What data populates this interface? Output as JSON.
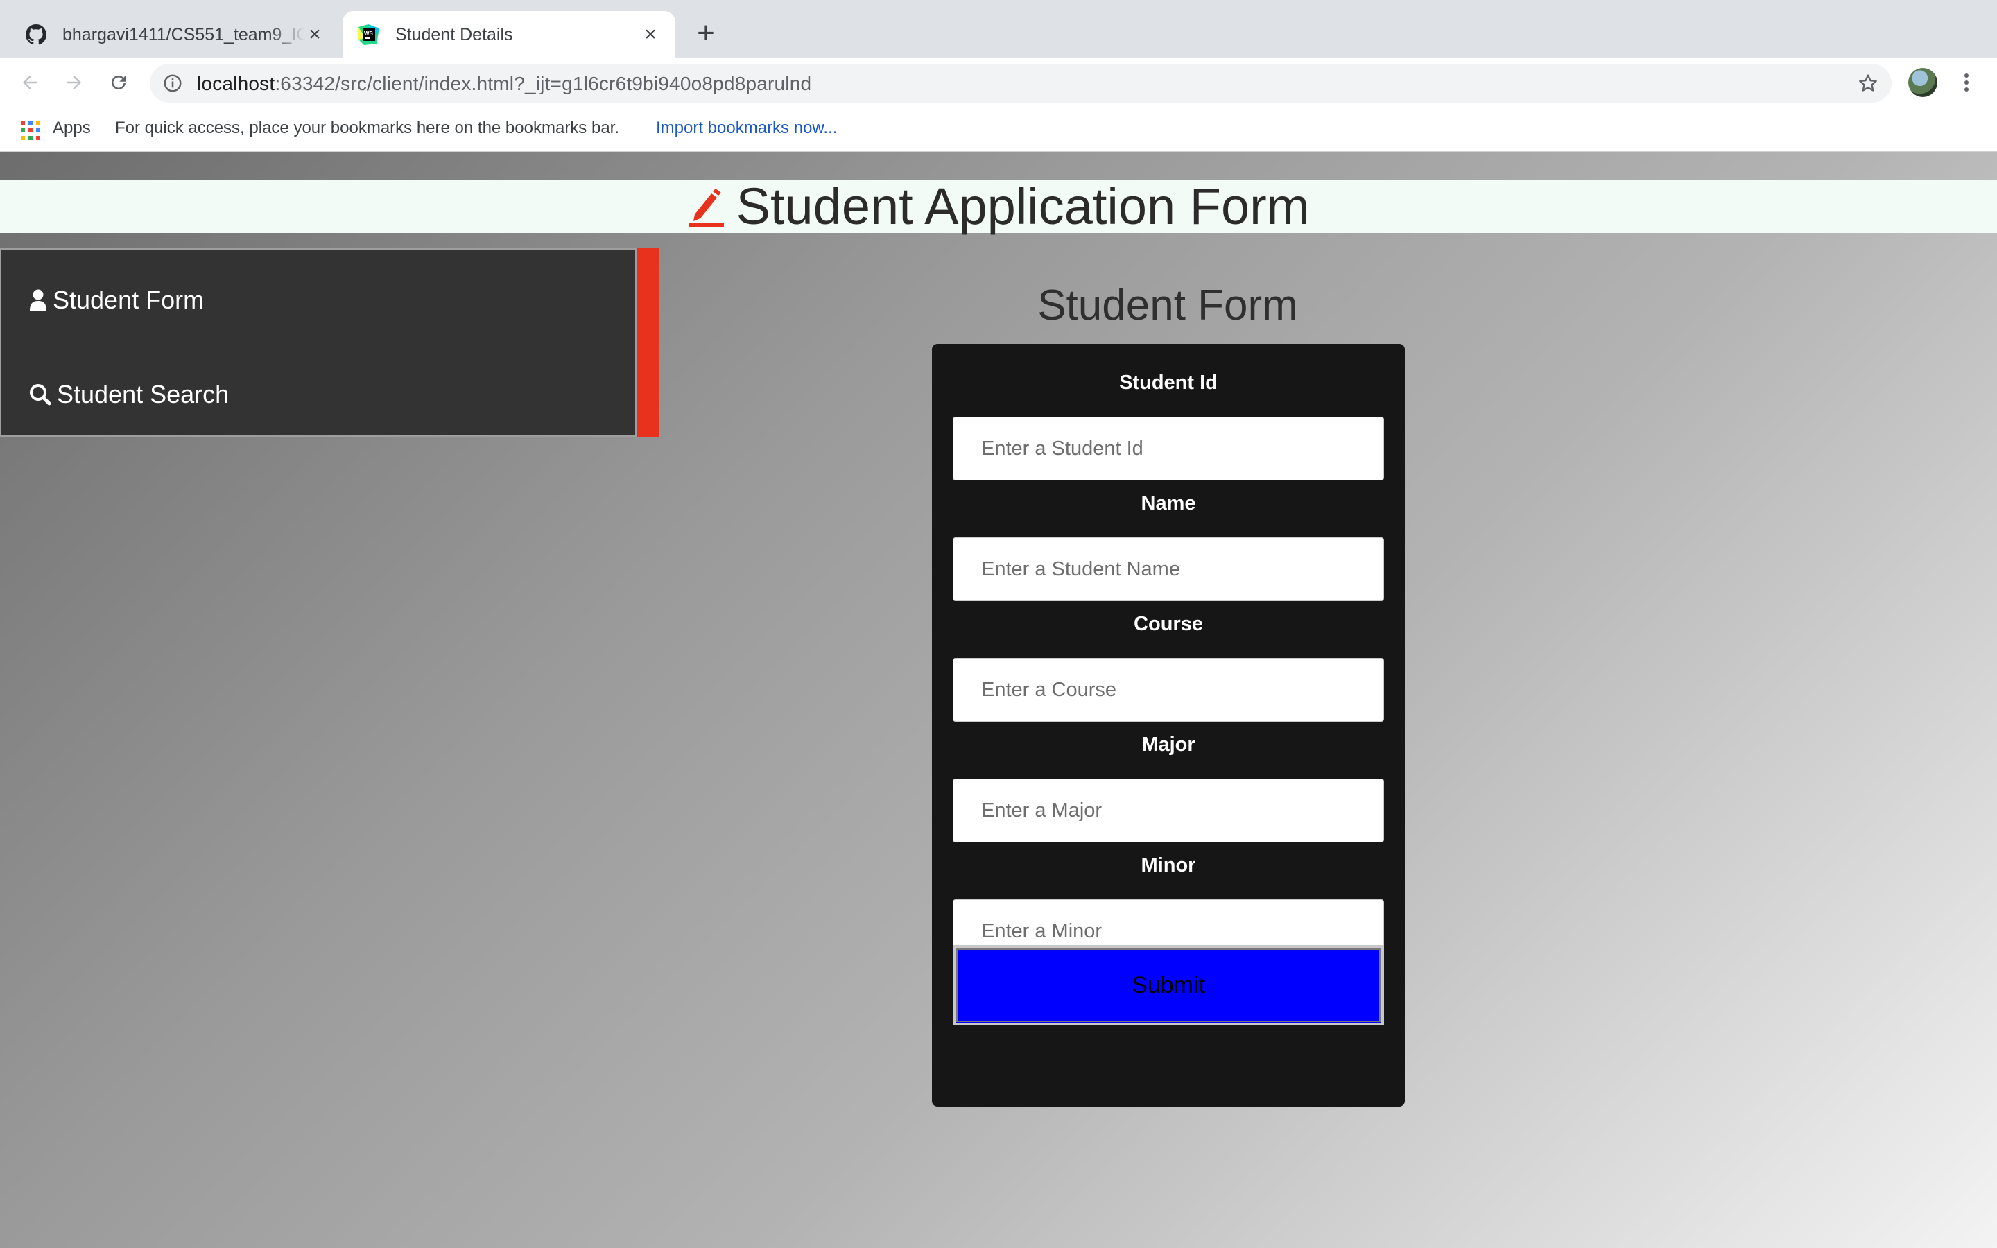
{
  "browser": {
    "tabs": [
      {
        "title": "bhargavi1411/CS551_team9_ICP",
        "icon": "github-icon",
        "active": false
      },
      {
        "title": "Student Details",
        "icon": "webstorm-icon",
        "active": true
      }
    ],
    "new_tab_label": "+",
    "url_host": "localhost",
    "url_rest": ":63342/src/client/index.html?_ijt=g1l6cr6t9bi940o8pd8parulnd",
    "bookmarks": {
      "apps_label": "Apps",
      "hint": "For quick access, place your bookmarks here on the bookmarks bar.",
      "import_link": "Import bookmarks now..."
    }
  },
  "header": {
    "title": "Student Application Form",
    "icon": "pencil-icon",
    "accent_color": "#e8321e"
  },
  "sidebar": {
    "items": [
      {
        "label": "Student Form",
        "icon": "user-icon"
      },
      {
        "label": "Student Search",
        "icon": "search-icon"
      }
    ]
  },
  "form": {
    "heading": "Student Form",
    "fields": [
      {
        "label": "Student Id",
        "placeholder": "Enter a Student Id"
      },
      {
        "label": "Name",
        "placeholder": "Enter a Student Name"
      },
      {
        "label": "Course",
        "placeholder": "Enter a Course"
      },
      {
        "label": "Major",
        "placeholder": "Enter a Major"
      },
      {
        "label": "Minor",
        "placeholder": "Enter a Minor"
      }
    ],
    "submit_label": "Submit",
    "submit_color": "#0000ff"
  }
}
